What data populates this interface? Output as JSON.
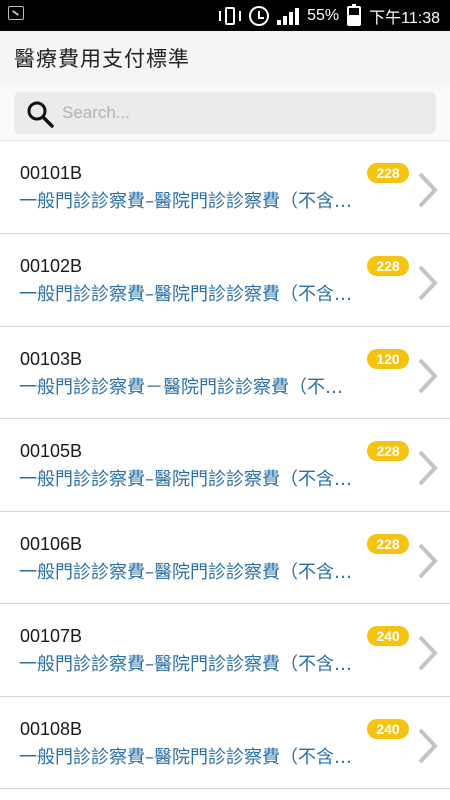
{
  "status": {
    "battery": "55%",
    "time": "下午11:38"
  },
  "header": {
    "title": "醫療費用支付標準"
  },
  "search": {
    "placeholder": "Search..."
  },
  "items": [
    {
      "code": "00101B",
      "desc": "一般門診診察費–醫院門診診察費（不含…",
      "count": "228"
    },
    {
      "code": "00102B",
      "desc": "一般門診診察費–醫院門診診察費（不含…",
      "count": "228"
    },
    {
      "code": "00103B",
      "desc": "一般門診診察費－醫院門診診察費（不…",
      "count": "120"
    },
    {
      "code": "00105B",
      "desc": "一般門診診察費–醫院門診診察費（不含…",
      "count": "228"
    },
    {
      "code": "00106B",
      "desc": "一般門診診察費–醫院門診診察費（不含…",
      "count": "228"
    },
    {
      "code": "00107B",
      "desc": "一般門診診察費–醫院門診診察費（不含…",
      "count": "240"
    },
    {
      "code": "00108B",
      "desc": "一般門診診察費–醫院門診診察費（不含…",
      "count": "240"
    }
  ],
  "colors": {
    "accent": "#2a6fa6",
    "badge": "#f5c312"
  }
}
